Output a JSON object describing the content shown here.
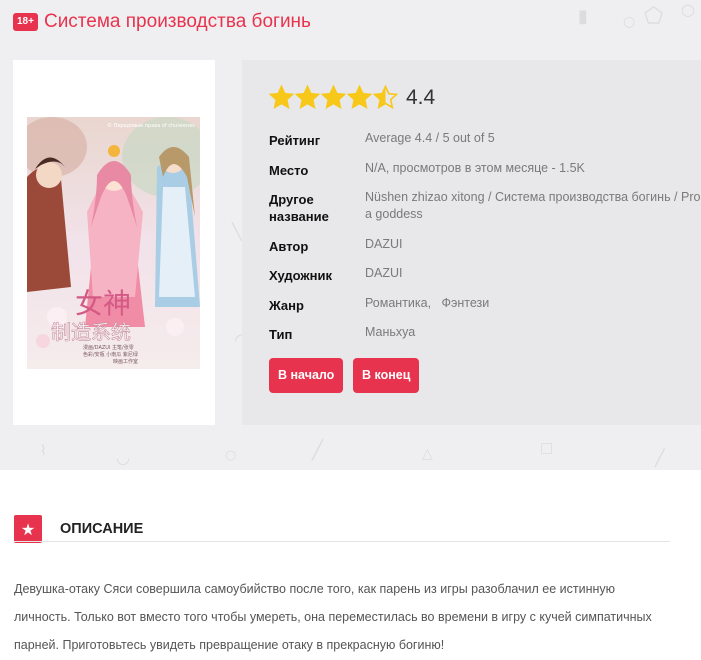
{
  "header": {
    "age_badge": "18+",
    "title": "Система производства богинь"
  },
  "rating": {
    "stars": 4.4,
    "max_stars": 5,
    "value_text": "4.4"
  },
  "info": [
    {
      "label": "Рейтинг",
      "value": "Average 4.4 / 5 out of 5"
    },
    {
      "label": "Место",
      "value": "N/A, просмотров в этом месяце - 1.5K"
    },
    {
      "label": "Другое название",
      "value": "Nüshen zhizao xitong / Система производства богинь / Pro a goddess"
    },
    {
      "label": "Автор",
      "value": "DAZUI"
    },
    {
      "label": "Художник",
      "value": "DAZUI"
    },
    {
      "label": "Жанр",
      "value": "Романтика,   Фэнтези"
    },
    {
      "label": "Тип",
      "value": "Маньхуа"
    }
  ],
  "buttons": {
    "first": "В начало",
    "last": "В конец"
  },
  "cover": {
    "header_text": "© Передовые права of chuiwenes",
    "title_cn": "女神",
    "subtitle_cn": "制造系统",
    "credits": "漫画/DAZUI  主笔/张零",
    "colors": "色彩/安瓶  小南瓜  紫尼绿",
    "studio": "映画工作室"
  },
  "description": {
    "heading": "ОПИСАНИЕ",
    "lines": [
      "Девушка-отаку Сяси совершила самоубийство после того, как парень из игры разоблачил ее истинную",
      "личность. Только вот вместо того чтобы умереть, она переместилась во времени в игру с кучей симпатичных",
      "парней. Приготовьтесь увидеть превращение отаку в прекрасную богиню!"
    ]
  },
  "colors": {
    "accent": "#e8334e",
    "star": "#f7c81a",
    "band": "#efeff1",
    "panel": "#e8e8ea"
  }
}
